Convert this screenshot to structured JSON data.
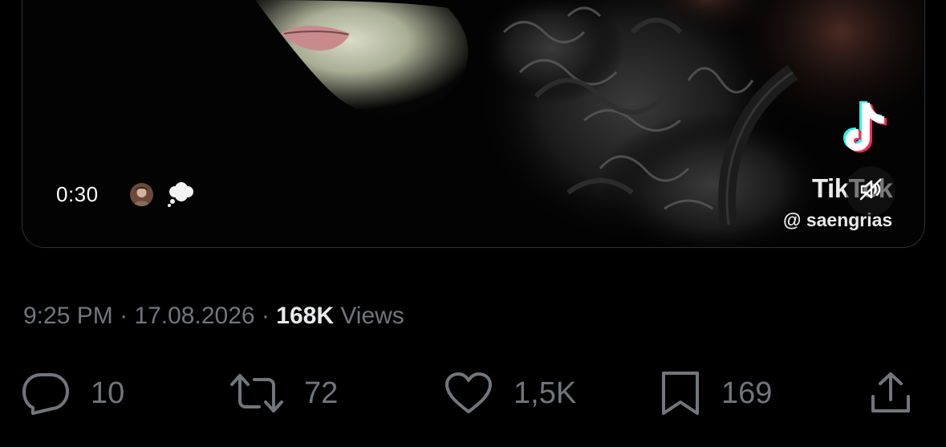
{
  "video": {
    "duration": "0:30",
    "overlay_icons": [
      "profile-avatar",
      "thought-bubble-emoji"
    ],
    "watermark": {
      "brand": "TikTok",
      "handle": "@ saengrias"
    },
    "muted": true
  },
  "meta": {
    "time": "9:25 PM",
    "separator": "·",
    "date": "17.08.2026",
    "views_count": "168K",
    "views_label": "Views"
  },
  "actions": {
    "reply": {
      "icon": "reply-icon",
      "count": "10"
    },
    "retweet": {
      "icon": "retweet-icon",
      "count": "72"
    },
    "like": {
      "icon": "heart-icon",
      "count": "1,5K"
    },
    "bookmark": {
      "icon": "bookmark-icon",
      "count": "169"
    },
    "share": {
      "icon": "share-icon"
    }
  },
  "colors": {
    "background": "#000000",
    "secondary_text": "#71767b",
    "primary_text": "#e7e9ea",
    "card_border": "#2f3336"
  }
}
